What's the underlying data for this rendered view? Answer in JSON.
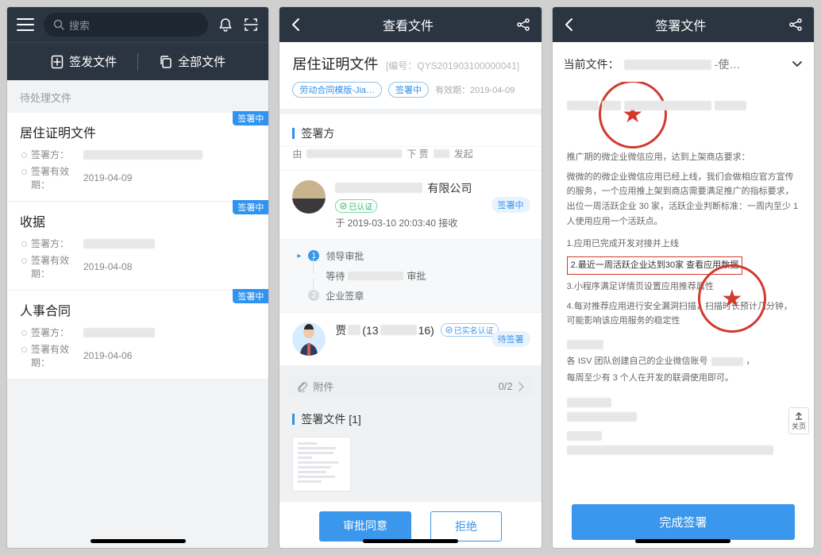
{
  "screen1": {
    "search_placeholder": "搜索",
    "tab_issue": "签发文件",
    "tab_all": "全部文件",
    "pending_label": "待处理文件",
    "files": [
      {
        "title": "居住证明文件",
        "signer_label": "签署方：",
        "expiry_label": "签署有效期：",
        "expiry": "2019-04-09",
        "badge": "签署中"
      },
      {
        "title": "收据",
        "signer_label": "签署方：",
        "expiry_label": "签署有效期：",
        "expiry": "2019-04-08",
        "badge": "签署中"
      },
      {
        "title": "人事合同",
        "signer_label": "签署方：",
        "expiry_label": "签署有效期：",
        "expiry": "2019-04-06",
        "badge": "签署中"
      }
    ]
  },
  "screen2": {
    "nav_title": "查看文件",
    "doc_title": "居住证明文件",
    "doc_code": "[编号：QYS201903100000041]",
    "chip_template": "劳动合同模版-Jia…",
    "chip_status": "签署中",
    "expiry_label": "有效期：2019-04-09",
    "signers_header": "签署方",
    "initiator_prefix": "由",
    "initiator_mid": "下 贾",
    "initiator_suffix": "发起",
    "company_suffix": "有限公司",
    "verified_badge": "已认证",
    "receive_time": "于 2019-03-10 20:03:40 接收",
    "status_signing": "签署中",
    "step1_title": "领导审批",
    "step1_wait": "等待",
    "step1_tail": "审批",
    "step2_title": "企业签章",
    "person_name_prefix": "贾",
    "person_phone_frag1": "(13",
    "person_phone_frag2": "16)",
    "realname_badge": "已实名认证",
    "status_wait": "待签署",
    "attach_label": "附件",
    "attach_count": "0/2",
    "sign_files_header": "签署文件 [1]",
    "btn_approve": "审批同意",
    "btn_reject": "拒绝"
  },
  "screen3": {
    "nav_title": "签署文件",
    "current_label": "当前文件：",
    "current_suffix": "-使…",
    "list1": "1.应用已完成开发对接并上线",
    "list2": "2.最近一周活跃企业达到30家 查看应用数据",
    "list3": "3.小程序满足详情页设置应用推荐属性",
    "list4": "4.每对推荐应用进行安全漏洞扫描，扫描时长预计几分钟，可能影响该应用服务的稳定性",
    "mid_line": "各 ISV 团队创建自己的企业微信账号",
    "mid_tail": "每周至少有 3 个人在开发的联调使用即可。",
    "top_line": "推广期的微企业微信应用，达到上架商店要求：",
    "top_line2": "微微的的微企业微信应用已经上线，我们会做相应官方宣传的服务，一个应用推上架到商店需要满足推广的指标要求，出位一周活跃企业 30 家，活跃企业判断标准：一周内至少 1 人使用应用一个活跃点。",
    "float_label": "关页",
    "btn_complete": "完成签署"
  }
}
